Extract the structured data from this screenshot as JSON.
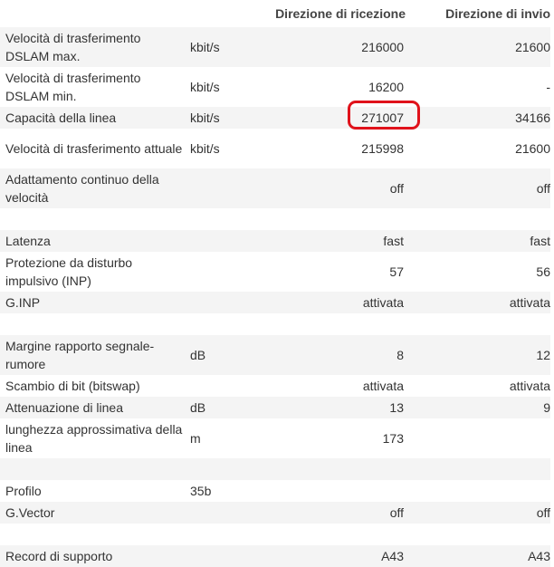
{
  "header": {
    "col_rx": "Direzione di ricezione",
    "col_tx": "Direzione di invio"
  },
  "rows": [
    {
      "label": "Velocità di trasferimento DSLAM max.",
      "unit": "kbit/s",
      "rx": "216000",
      "tx": "21600"
    },
    {
      "label": "Velocità di trasferimento DSLAM min.",
      "unit": "kbit/s",
      "rx": "16200",
      "tx": "-"
    },
    {
      "label": "Capacità della linea",
      "unit": "kbit/s",
      "rx": "271007",
      "tx": "34166"
    },
    {
      "label": "Velocità di trasferimento attuale",
      "unit": "kbit/s",
      "rx": "215998",
      "tx": "21600"
    },
    {
      "label": "Adattamento continuo della velocità",
      "unit": "",
      "rx": "off",
      "tx": "off"
    },
    {
      "label": "",
      "unit": "",
      "rx": "",
      "tx": ""
    },
    {
      "label": "Latenza",
      "unit": "",
      "rx": "fast",
      "tx": "fast"
    },
    {
      "label": "Protezione da disturbo impulsivo (INP)",
      "unit": "",
      "rx": "57",
      "tx": "56"
    },
    {
      "label": "G.INP",
      "unit": "",
      "rx": "attivata",
      "tx": "attivata"
    },
    {
      "label": "",
      "unit": "",
      "rx": "",
      "tx": ""
    },
    {
      "label": "Margine rapporto segnale-rumore",
      "unit": "dB",
      "rx": "8",
      "tx": "12"
    },
    {
      "label": "Scambio di bit (bitswap)",
      "unit": "",
      "rx": "attivata",
      "tx": "attivata"
    },
    {
      "label": "Attenuazione di linea",
      "unit": "dB",
      "rx": "13",
      "tx": "9"
    },
    {
      "label": "lunghezza approssimativa della linea",
      "unit": "m",
      "rx": "173",
      "tx": ""
    },
    {
      "label": "",
      "unit": "",
      "rx": "",
      "tx": ""
    },
    {
      "label": "Profilo",
      "unit": "35b",
      "rx": "",
      "tx": ""
    },
    {
      "label": "G.Vector",
      "unit": "",
      "rx": "off",
      "tx": "off"
    },
    {
      "label": "",
      "unit": "",
      "rx": "",
      "tx": ""
    },
    {
      "label": "Record di supporto",
      "unit": "",
      "rx": "A43",
      "tx": "A43"
    }
  ],
  "highlight_color": "#e0121b",
  "zebra_color": "#f4f4f4"
}
